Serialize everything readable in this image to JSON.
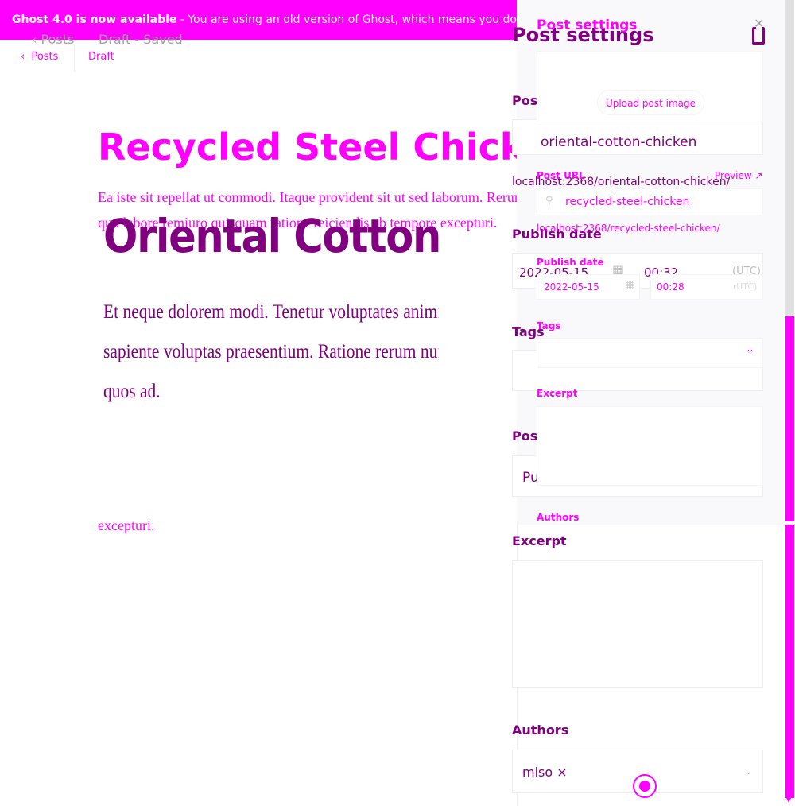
{
  "banner": {
    "title": "Ghost 4.0 is now available",
    "message": " - You are using an old version of Ghost, which means you don't have ac"
  },
  "header": {
    "back_label": "Posts",
    "status_label": "Draft",
    "ghost_back_label": "Posts",
    "ghost_status": "Draft - Saved"
  },
  "editor": {
    "title_back": "Recycled Steel Chicken",
    "body_back": "Ea iste sit repellat ut commodi. Itaque provident sit ut sed laborum. Rerum quo labore remiuro quisquam ratione reiciendis ab tempore excepturi.",
    "title_front": "Oriental Cotton Chicken",
    "body_front_line1": "Et neque dolorem modi. Tenetur voluptates animi velit quidem",
    "body_front_line2": "sapiente voluptas praesentium. Ratione rerum numquam. Quos",
    "body_front_line3": "quos ad.",
    "body_tail": "excepturi."
  },
  "settings_back": {
    "title": "Post settings",
    "post_url_label": "Post URL",
    "post_url_value": "oriental-cotton-chicken",
    "post_url_full": "localhost:2368/oriental-cotton-chicken/",
    "publish_date_label": "Publish date",
    "date_value": "2022-05-15",
    "time_value": "00:32",
    "timezone": "(UTC)",
    "tags_label": "Tags",
    "post_access_label": "Post access",
    "post_access_value": "Public",
    "excerpt_label": "Excerpt",
    "authors_label": "Authors",
    "author_value": "miso",
    "author_remove": "×"
  },
  "settings_front": {
    "title": "Post settings",
    "upload_label": "Upload post image",
    "post_url_label": "Post URL",
    "preview_label": "Preview",
    "post_url_value": "recycled-steel-chicken",
    "post_url_full": "localhost:2368/recycled-steel-chicken/",
    "publish_date_label": "Publish date",
    "date_value": "2022-05-15",
    "time_value": "00:28",
    "timezone": "(UTC)",
    "tags_label": "Tags",
    "excerpt_label": "Excerpt",
    "authors_label": "Authors"
  },
  "icons": {
    "close": "close-icon",
    "sidebar": "sidebar-toggle-icon",
    "calendar": "calendar-icon",
    "link": "link-icon",
    "chevron": "chevron-down-icon"
  },
  "colors": {
    "accent": "#ff00ff",
    "accent_dark": "#800080",
    "muted": "#a0a0a0"
  }
}
